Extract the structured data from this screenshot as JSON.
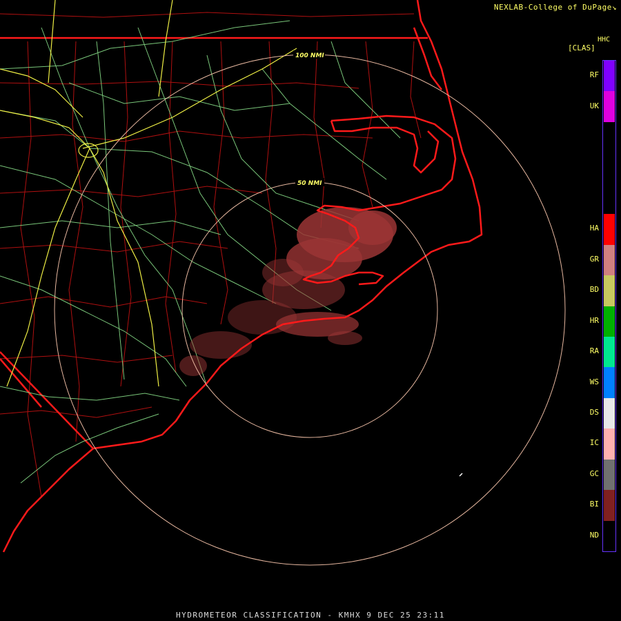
{
  "credit": "NEXLAB-College of DuPage",
  "credit_mark": "↘",
  "product_code": "HHC",
  "product_short": "[CLAS]",
  "range_rings": [
    {
      "label": "50 NMI"
    },
    {
      "label": "100 NMI"
    }
  ],
  "legend": [
    {
      "code": "RF",
      "color": "#8000ff"
    },
    {
      "code": "UK",
      "color": "#e000e0"
    },
    {
      "code": "",
      "color": "#000000"
    },
    {
      "code": "",
      "color": "#000000"
    },
    {
      "code": "",
      "color": "#000000"
    },
    {
      "code": "HA",
      "color": "#ff0000"
    },
    {
      "code": "GR",
      "color": "#d08080"
    },
    {
      "code": "BD",
      "color": "#c8c860"
    },
    {
      "code": "HR",
      "color": "#00b000"
    },
    {
      "code": "RA",
      "color": "#00e890"
    },
    {
      "code": "WS",
      "color": "#0080ff"
    },
    {
      "code": "DS",
      "color": "#e8e8e8"
    },
    {
      "code": "IC",
      "color": "#ffb0b0"
    },
    {
      "code": "GC",
      "color": "#707070"
    },
    {
      "code": "BI",
      "color": "#802020"
    },
    {
      "code": "ND",
      "color": "#000000"
    }
  ],
  "caption": "HYDROMETEOR CLASSIFICATION - KMHX 9 DEC 25 23:11",
  "colors": {
    "coast": "#ff1a1a",
    "county": "#cc1111",
    "highway": "#88dd88",
    "interstate": "#eeee44",
    "ring": "#e8b8a0",
    "echo": "#9b3535"
  }
}
